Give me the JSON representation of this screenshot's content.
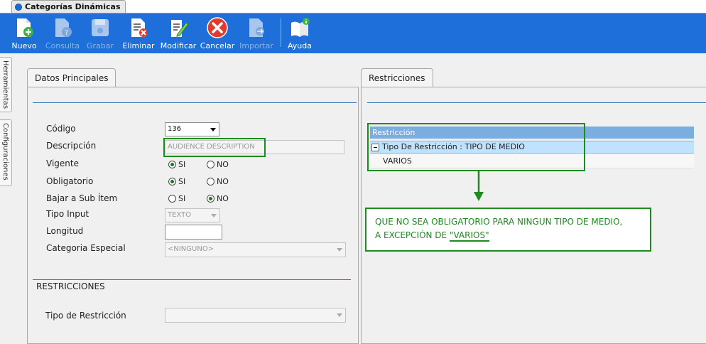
{
  "window": {
    "tab_title": "Categorías Dinámicas"
  },
  "toolbar": {
    "buttons": [
      {
        "label": "Nuevo",
        "icon": "new-document-plus-icon",
        "enabled": true
      },
      {
        "label": "Consulta",
        "icon": "document-help-icon",
        "enabled": false
      },
      {
        "label": "Grabar",
        "icon": "floppy-disk-icon",
        "enabled": false
      },
      {
        "label": "Eliminar",
        "icon": "document-delete-icon",
        "enabled": true
      },
      {
        "label": "Modificar",
        "icon": "document-edit-pencil-icon",
        "enabled": true
      },
      {
        "label": "Cancelar",
        "icon": "cancel-x-icon",
        "enabled": true
      },
      {
        "label": "Importar",
        "icon": "document-import-icon",
        "enabled": false
      },
      {
        "label": "Ayuda",
        "icon": "book-info-icon",
        "enabled": true
      }
    ]
  },
  "side_tabs": [
    "Herramientas",
    "Configuraciones"
  ],
  "left_panel": {
    "tab": "Datos Principales",
    "fields": {
      "codigo": {
        "label": "Código",
        "value": "136"
      },
      "descripcion": {
        "label": "Descripción",
        "value": "AUDIENCE DESCRIPTION"
      },
      "vigente": {
        "label": "Vigente",
        "si": "SI",
        "no": "NO",
        "selected": "SI"
      },
      "obligatorio": {
        "label": "Obligatorio",
        "si": "SI",
        "no": "NO",
        "selected": "SI"
      },
      "bajar": {
        "label": "Bajar a Sub Ítem",
        "si": "SI",
        "no": "NO",
        "selected": "NO"
      },
      "tipo_input": {
        "label": "Tipo Input",
        "value": "TEXTO"
      },
      "longitud": {
        "label": "Longitud",
        "value": ""
      },
      "categoria_especial": {
        "label": "Categoria Especial",
        "value": "<NINGUNO>"
      }
    },
    "restricciones": {
      "heading": "RESTRICCIONES",
      "tipo_label": "Tipo de Restricción",
      "tipo_value": ""
    }
  },
  "right_panel": {
    "tab": "Restricciones",
    "grid": {
      "header": "Restricción",
      "group_row": "Tipo De Restricción : TIPO DE MEDIO",
      "rows": [
        "VARIOS"
      ]
    }
  },
  "annotation": {
    "line1": "QUE NO SEA OBLIGATORIO PARA NINGUN TIPO DE MEDIO,",
    "line2_prefix": "A EXCEPCIÓN DE ",
    "line2_quoted": "\"VARIOS\"",
    "color": "#1f8a1f"
  },
  "colors": {
    "toolbar_bg": "#1e6fd9",
    "accent_line": "#2f74b5",
    "grid_header": "#7aaee0",
    "grid_selected": "#bfe3ff"
  }
}
